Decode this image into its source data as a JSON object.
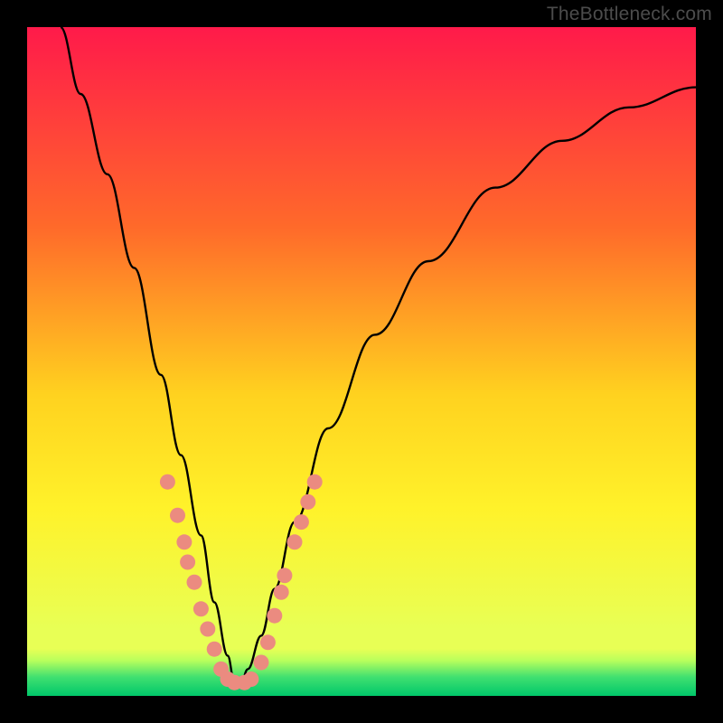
{
  "watermark": "TheBottleneck.com",
  "colors": {
    "black": "#000000",
    "gradient_top": "#ff1a4a",
    "gradient_mid1": "#ff6a2a",
    "gradient_mid2": "#ffd21f",
    "gradient_mid3": "#fff22a",
    "gradient_low": "#e8ff55",
    "green_top": "#b8ff5c",
    "green_mid": "#40e070",
    "green_bot": "#00c76a",
    "curve": "#000000",
    "marker": "#eb8b80"
  },
  "chart_data": {
    "type": "line",
    "title": "",
    "xlabel": "",
    "ylabel": "",
    "xlim": [
      0,
      100
    ],
    "ylim": [
      0,
      100
    ],
    "note": "Axes implied by plot edges; values are percent of plot width/height. Curve is a V-shaped bottleneck profile with minimum near x≈31.",
    "series": [
      {
        "name": "bottleneck-curve",
        "x": [
          5,
          8,
          12,
          16,
          20,
          23,
          26,
          28,
          30,
          31,
          32,
          33,
          35,
          37,
          40,
          45,
          52,
          60,
          70,
          80,
          90,
          100
        ],
        "y": [
          100,
          90,
          78,
          64,
          48,
          36,
          24,
          14,
          6,
          2,
          2,
          4,
          9,
          16,
          26,
          40,
          54,
          65,
          76,
          83,
          88,
          91
        ]
      }
    ],
    "markers": {
      "name": "highlighted-points",
      "points": [
        {
          "x": 21,
          "y": 32
        },
        {
          "x": 22.5,
          "y": 27
        },
        {
          "x": 23.5,
          "y": 23
        },
        {
          "x": 24,
          "y": 20
        },
        {
          "x": 25,
          "y": 17
        },
        {
          "x": 26,
          "y": 13
        },
        {
          "x": 27,
          "y": 10
        },
        {
          "x": 28,
          "y": 7
        },
        {
          "x": 29,
          "y": 4
        },
        {
          "x": 30,
          "y": 2.5
        },
        {
          "x": 31,
          "y": 2
        },
        {
          "x": 32.5,
          "y": 2
        },
        {
          "x": 33.5,
          "y": 2.5
        },
        {
          "x": 35,
          "y": 5
        },
        {
          "x": 36,
          "y": 8
        },
        {
          "x": 37,
          "y": 12
        },
        {
          "x": 38,
          "y": 15.5
        },
        {
          "x": 38.5,
          "y": 18
        },
        {
          "x": 40,
          "y": 23
        },
        {
          "x": 41,
          "y": 26
        },
        {
          "x": 42,
          "y": 29
        },
        {
          "x": 43,
          "y": 32
        }
      ]
    }
  }
}
